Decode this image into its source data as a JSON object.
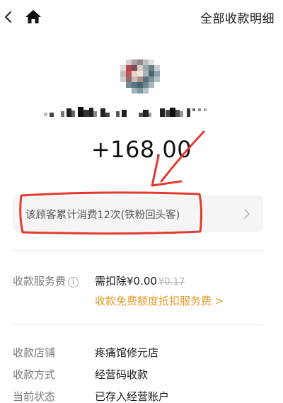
{
  "topbar": {
    "right_link": "全部收款明细"
  },
  "payment": {
    "amount": "+168.00"
  },
  "loyalty": {
    "text": "该顾客累计消费12次(铁粉回头客)"
  },
  "fee": {
    "label": "收款服务费",
    "deduct_text": "需扣除¥0.00",
    "original_fee": "¥0.17",
    "promo_link": "收款免费额度抵扣服务费 >"
  },
  "details": [
    {
      "label": "收款店铺",
      "value": "疼痛馆修元店"
    },
    {
      "label": "收款方式",
      "value": "经营码收款"
    },
    {
      "label": "当前状态",
      "value": "已存入经营账户"
    }
  ],
  "colors": {
    "accent_orange": "#e79a2b",
    "annotation_red": "#e33a2f"
  }
}
